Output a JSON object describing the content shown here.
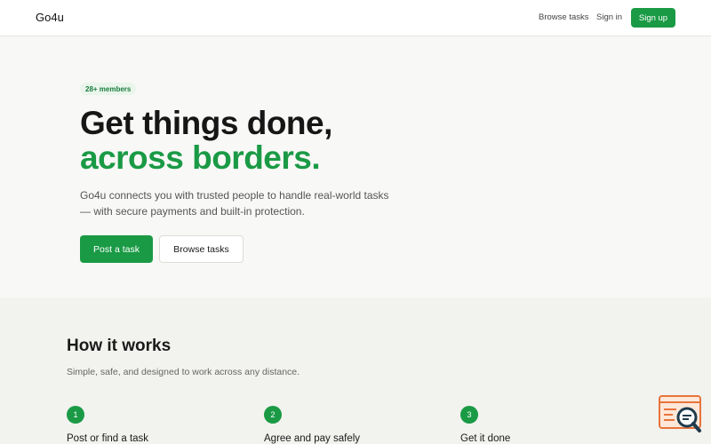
{
  "header": {
    "brand": "Go4u",
    "nav": {
      "browse_tasks": "Browse tasks",
      "sign_in": "Sign in",
      "sign_up": "Sign up"
    }
  },
  "hero": {
    "badge": "28+ members",
    "headline_line1": "Get things done,",
    "headline_line2": "across borders.",
    "subtext": "Go4u connects you with trusted people to handle real-world tasks — with secure payments and built-in protection.",
    "primary_cta": "Post a task",
    "secondary_cta": "Browse tasks"
  },
  "how_it_works": {
    "title": "How it works",
    "subtitle": "Simple, safe, and designed to work across any distance.",
    "steps": [
      {
        "number": "1",
        "title": "Post or find a task"
      },
      {
        "number": "2",
        "title": "Agree and pay safely"
      },
      {
        "number": "3",
        "title": "Get it done"
      }
    ]
  },
  "colors": {
    "accent": "#1a9a45",
    "widget": "#e8743b"
  },
  "icons": {
    "help_widget": "search-chat-icon"
  }
}
